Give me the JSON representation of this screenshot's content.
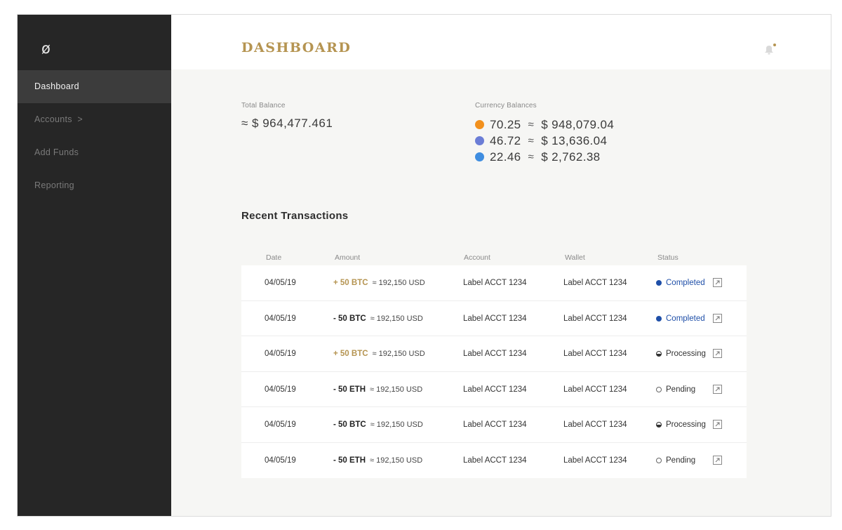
{
  "logo": "ø",
  "sidebar": {
    "items": [
      {
        "label": "Dashboard",
        "active": true
      },
      {
        "label": "Accounts  >"
      },
      {
        "label": "Add Funds"
      },
      {
        "label": "Reporting"
      }
    ]
  },
  "header": {
    "title": "DASHBOARD",
    "bell_icon": "bell-icon"
  },
  "balance": {
    "label": "Total Balance",
    "value": "≈ $ 964,477.461"
  },
  "currency": {
    "label": "Currency Balances",
    "rows": [
      {
        "icon": "bitcoin-icon",
        "color": "#f2901c",
        "amount": "70.25",
        "approx": "≈",
        "usd": "$ 948,079.04"
      },
      {
        "icon": "ethereum-icon",
        "color": "#6b7dd6",
        "amount": "46.72",
        "approx": "≈",
        "usd": "$ 13,636.04"
      },
      {
        "icon": "litecoin-icon",
        "color": "#3f8de0",
        "amount": "22.46",
        "approx": "≈",
        "usd": "$ 2,762.38"
      }
    ]
  },
  "transactions": {
    "title": "Recent Transactions",
    "headers": [
      "Date",
      "Amount",
      "Account",
      "Wallet",
      "Status"
    ],
    "rows": [
      {
        "date": "04/05/19",
        "amount": "+ 50 BTC",
        "sign": "pos",
        "usd": "≈ 192,150 USD",
        "account": "Label ACCT 1234",
        "wallet": "Label ACCT 1234",
        "status": "Completed"
      },
      {
        "date": "04/05/19",
        "amount": "- 50 BTC",
        "sign": "neg",
        "usd": "≈ 192,150 USD",
        "account": "Label ACCT 1234",
        "wallet": "Label ACCT 1234",
        "status": "Completed"
      },
      {
        "date": "04/05/19",
        "amount": "+ 50 BTC",
        "sign": "pos",
        "usd": "≈ 192,150 USD",
        "account": "Label ACCT 1234",
        "wallet": "Label ACCT 1234",
        "status": "Processing"
      },
      {
        "date": "04/05/19",
        "amount": "- 50 ETH",
        "sign": "neg",
        "usd": "≈ 192,150 USD",
        "account": "Label ACCT 1234",
        "wallet": "Label ACCT 1234",
        "status": "Pending"
      },
      {
        "date": "04/05/19",
        "amount": "- 50 BTC",
        "sign": "neg",
        "usd": "≈ 192,150 USD",
        "account": "Label ACCT 1234",
        "wallet": "Label ACCT 1234",
        "status": "Processing"
      },
      {
        "date": "04/05/19",
        "amount": "- 50 ETH",
        "sign": "neg",
        "usd": "≈ 192,150 USD",
        "account": "Label ACCT 1234",
        "wallet": "Label ACCT 1234",
        "status": "Pending"
      }
    ]
  },
  "colors": {
    "accent": "#b59451",
    "sidebar": "#262626",
    "completed": "#1f4fa8"
  }
}
